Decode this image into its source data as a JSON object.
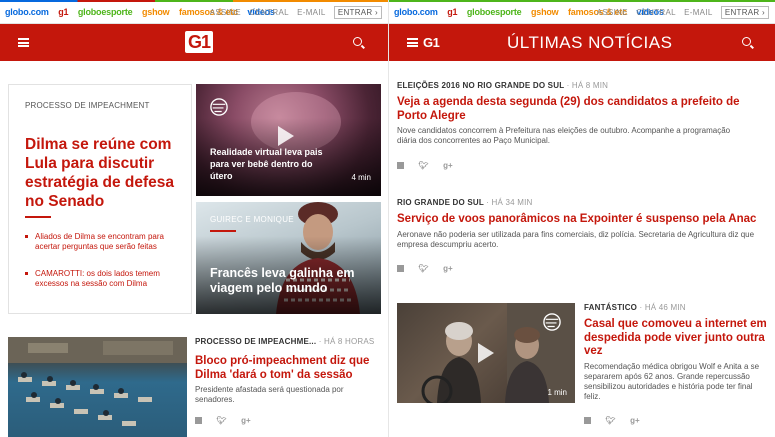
{
  "globobar": {
    "links": [
      {
        "label": "globo.com",
        "color": "#0669de"
      },
      {
        "label": "g1",
        "color": "#c4170c"
      },
      {
        "label": "globoesporte",
        "color": "#4eb51b"
      },
      {
        "label": "gshow",
        "color": "#f28b00"
      },
      {
        "label": "famosos & etc",
        "color": "#f28b00"
      },
      {
        "label": "vídeos",
        "color": "#0669de"
      }
    ],
    "right": [
      "ASSINE",
      "CENTRAL",
      "E-MAIL"
    ],
    "entrar": "ENTRAR ›"
  },
  "colors": {
    "brand": "#c4170c"
  },
  "left_header": {
    "logo": "G1"
  },
  "right_header": {
    "logo": "G1",
    "title": "ÚLTIMAS NOTÍCIAS"
  },
  "feature": {
    "section": "PROCESSO DE IMPEACHMENT",
    "headline": "Dilma se reúne com Lula para discutir estratégia de defesa no Senado",
    "bullets": [
      "Aliados de Dilma se encontram para acertar perguntas que serão feitas",
      "CAMAROTTI: os dois lados temem excessos na sessão com Dilma"
    ]
  },
  "video_card": {
    "title": "Realidade virtual leva pais para ver bebê dentro do útero",
    "duration": "4 min"
  },
  "photo_card": {
    "credit": "GUIREC E MONIQUE",
    "title": "Francês leva galinha em viagem pelo mundo"
  },
  "bottom_story": {
    "section": "PROCESSO DE IMPEACHME...",
    "time": "· HÁ 8 HORAS",
    "headline": "Bloco pró-impeachment diz que Dilma 'dará o tom' da sessão",
    "summary": "Presidente afastada será questionada por senadores."
  },
  "latest": [
    {
      "section": "ELEIÇÕES 2016 NO RIO GRANDE DO SUL",
      "time": "· HÁ 8 MIN",
      "headline": "Veja a agenda desta segunda (29) dos candidatos a prefeito de Porto Alegre",
      "summary": "Nove candidatos concorrem à Prefeitura nas eleições de outubro. Acompanhe a programação diária dos concorrentes ao Paço Municipal."
    },
    {
      "section": "RIO GRANDE DO SUL",
      "time": "· HÁ 34 MIN",
      "headline": "Serviço de voos panorâmicos na Expointer é suspenso pela Anac",
      "summary": "Aeronave não poderia ser utilizada para fins comerciais, diz polícia. Secretaria de Agricultura diz que empresa descumpriu acerto."
    },
    {
      "section": "FANTÁSTICO",
      "time": "· HÁ 46 MIN",
      "headline": "Casal que comoveu a internet em despedida pode viver junto outra vez",
      "summary": "Recomendação médica obrigou Wolf e Anita a se separarem após 62 anos. Grande repercussão sensibilizou autoridades e história pode ter final feliz.",
      "duration": "1 min"
    }
  ]
}
